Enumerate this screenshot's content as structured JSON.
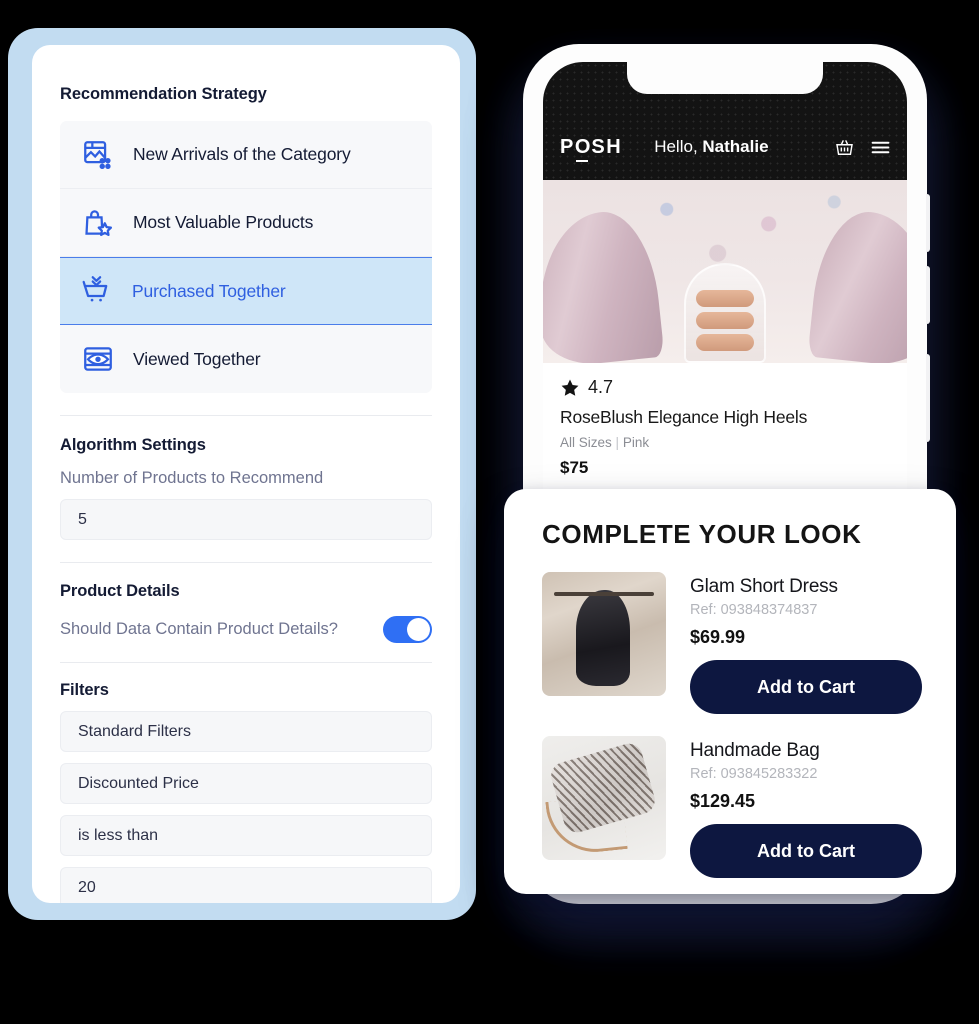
{
  "settings_panel": {
    "sections": {
      "strategy_title": "Recommendation Strategy",
      "algorithm_title": "Algorithm Settings",
      "product_details_title": "Product Details",
      "filters_title": "Filters"
    },
    "strategies": [
      {
        "label": "New Arrivals of the Category",
        "icon": "new-arrivals-icon",
        "selected": false
      },
      {
        "label": "Most Valuable Products",
        "icon": "valuable-products-icon",
        "selected": false
      },
      {
        "label": "Purchased Together",
        "icon": "shopping-cart-icon",
        "selected": true
      },
      {
        "label": "Viewed Together",
        "icon": "eye-view-icon",
        "selected": false
      }
    ],
    "algorithm": {
      "number_label": "Number of Products to Recommend",
      "number_value": "5"
    },
    "product_details": {
      "toggle_label": "Should Data Contain Product Details?",
      "toggle_on": true
    },
    "filters": [
      {
        "value": "Standard Filters"
      },
      {
        "value": "Discounted Price"
      },
      {
        "value": "is less than"
      },
      {
        "value": "20"
      }
    ],
    "colors": {
      "accent_blue": "#2f5fe0",
      "selected_row_bg": "#cfe6f8",
      "toggle_on": "#2f6ff4",
      "frame": "#c2dcf1"
    }
  },
  "phone": {
    "app_bar": {
      "logo": "POSH",
      "logo_parts": {
        "p": "P",
        "o": "O",
        "sh": "SH"
      },
      "greeting_prefix": "Hello, ",
      "greeting_name": "Nathalie",
      "basket_icon": "shopping-basket-icon",
      "menu_icon": "hamburger-menu-icon"
    },
    "product": {
      "rating_icon": "star-icon",
      "rating": "4.7",
      "title": "RoseBlush Elegance High Heels",
      "sizes": "All Sizes",
      "separator": "|",
      "color": "Pink",
      "price": "$75"
    }
  },
  "complete_your_look": {
    "heading": "COMPLETE YOUR LOOK",
    "items": [
      {
        "name": "Glam Short Dress",
        "ref": "Ref: 093848374837",
        "price": "$69.99",
        "button": "Add to Cart",
        "thumb": "dress-thumbnail"
      },
      {
        "name": "Handmade Bag",
        "ref": "Ref: 093845283322",
        "price": "$129.45",
        "button": "Add to Cart",
        "thumb": "bag-thumbnail"
      }
    ],
    "button_color": "#0d1740"
  }
}
